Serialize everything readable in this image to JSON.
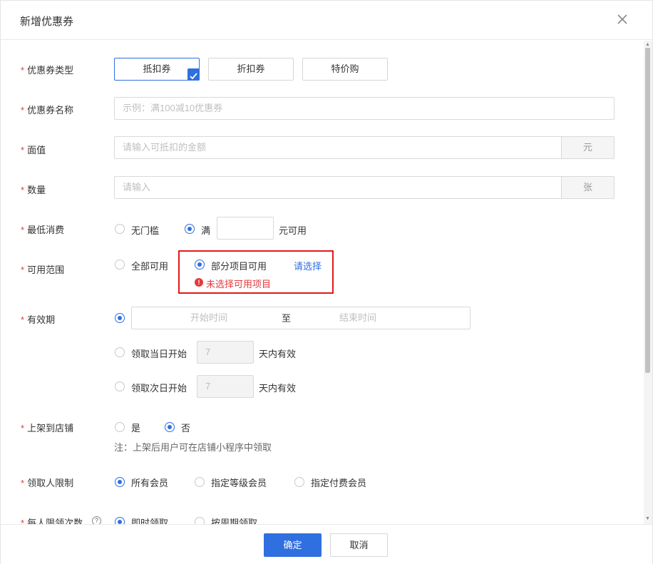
{
  "dialog": {
    "title": "新增优惠券",
    "close_icon": "close-icon"
  },
  "form": {
    "required_mark": "*",
    "coupon_type": {
      "label": "优惠券类型",
      "options": [
        "抵扣券",
        "折扣券",
        "特价购"
      ],
      "selected": "抵扣券"
    },
    "coupon_name": {
      "label": "优惠券名称",
      "placeholder": "示例：满100减10优惠券"
    },
    "face_value": {
      "label": "面值",
      "placeholder": "请输入可抵扣的金额",
      "unit": "元"
    },
    "quantity": {
      "label": "数量",
      "placeholder": "请输入",
      "unit": "张"
    },
    "min_spend": {
      "label": "最低消费",
      "option_none": "无门槛",
      "option_full": "满",
      "suffix": "元可用",
      "selected": "满"
    },
    "scope": {
      "label": "可用范围",
      "option_all": "全部可用",
      "option_partial": "部分项目可用",
      "select_link": "请选择",
      "error": "未选择可用项目",
      "selected": "部分项目可用"
    },
    "validity": {
      "label": "有效期",
      "start_placeholder": "开始时间",
      "separator": "至",
      "end_placeholder": "结束时间",
      "option_same_day": "领取当日开始",
      "option_next_day": "领取次日开始",
      "days_value_1": "7",
      "days_value_2": "7",
      "days_suffix": "天内有效"
    },
    "list_on_store": {
      "label": "上架到店铺",
      "option_yes": "是",
      "option_no": "否",
      "selected": "否",
      "note": "注：上架后用户可在店铺小程序中领取"
    },
    "receiver_limit": {
      "label": "领取人限制",
      "options": [
        "所有会员",
        "指定等级会员",
        "指定付费会员"
      ],
      "selected": "所有会员"
    },
    "per_person_limit": {
      "label": "每人限领次数",
      "help_icon": "question-circle-icon",
      "options": [
        "即时领取",
        "按周期领取"
      ],
      "selected": "即时领取"
    }
  },
  "footer": {
    "confirm_label": "确定",
    "cancel_label": "取消"
  },
  "colors": {
    "primary": "#2f6fe0",
    "error": "#e4393c",
    "highlight_box": "#e01a1a"
  }
}
